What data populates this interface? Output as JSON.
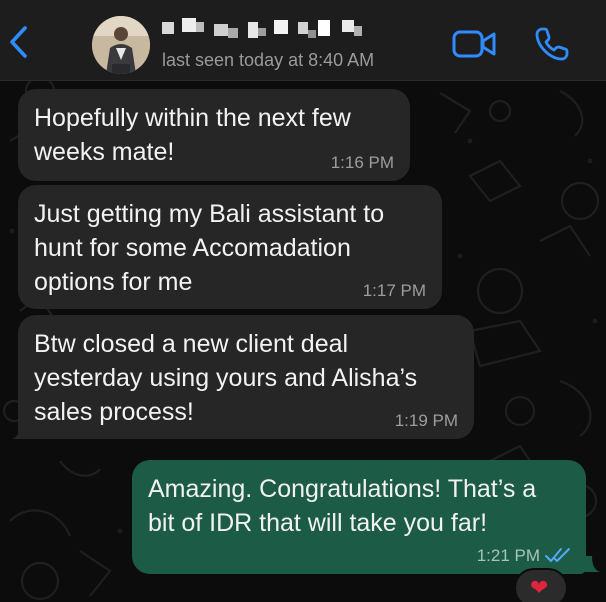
{
  "header": {
    "contact_status": "last seen today at 8:40 AM"
  },
  "icons": {
    "back": "chevron-left-icon",
    "video": "video-camera-icon",
    "call": "phone-icon",
    "read": "double-check-icon",
    "reaction": "heart-icon"
  },
  "colors": {
    "accent": "#2f8cff",
    "incoming_bubble": "#262626",
    "outgoing_bubble": "#1c5c46",
    "header_bg": "#1d1d1d"
  },
  "messages": [
    {
      "direction": "incoming",
      "text": "Hopefully within the next few\nweeks mate!",
      "time": "1:16 PM"
    },
    {
      "direction": "incoming",
      "text": "Just getting my Bali assistant to\nhunt for some Accomadation\noptions for me",
      "time": "1:17 PM"
    },
    {
      "direction": "incoming",
      "text": "Btw closed a new client deal\nyesterday using yours and Alisha’s\nsales process!",
      "time": "1:19 PM"
    },
    {
      "direction": "outgoing",
      "text": "Amazing. Congratulations! That’s a\nbit of IDR that will take you far!",
      "time": "1:21 PM",
      "reaction": "❤"
    }
  ]
}
